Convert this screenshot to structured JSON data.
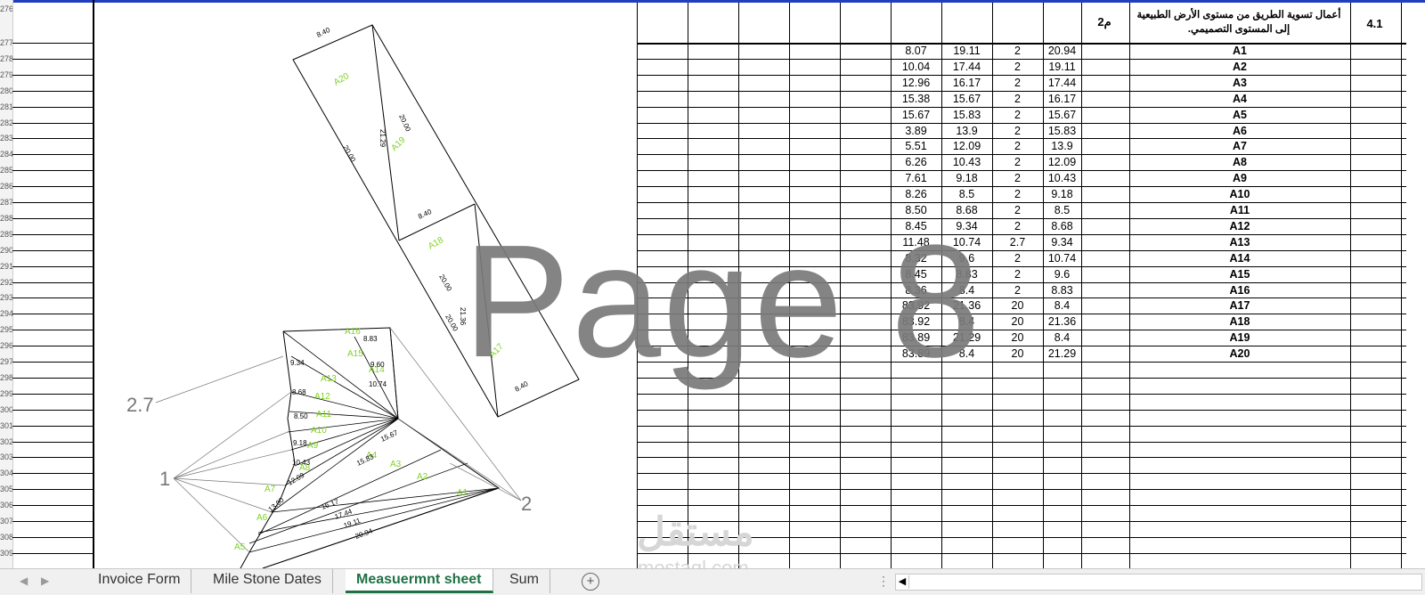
{
  "row_numbers": [
    "276",
    "277",
    "278",
    "279",
    "280",
    "281",
    "282",
    "283",
    "284",
    "285",
    "286",
    "287",
    "288",
    "289",
    "290",
    "291",
    "292",
    "293",
    "294",
    "295",
    "296",
    "297",
    "298",
    "299",
    "300",
    "301",
    "302",
    "303",
    "304",
    "305",
    "306",
    "307",
    "308",
    "309"
  ],
  "table": {
    "header": {
      "code": "4.1",
      "title": "أعمال تسوية الطريق من مستوى الأرض الطبيعية إلى المستوى التصميمي.",
      "unit": "م2"
    },
    "rows": [
      {
        "v1": "8.07",
        "v2": "19.11",
        "v3": "2",
        "v4": "20.94",
        "label": "A1"
      },
      {
        "v1": "10.04",
        "v2": "17.44",
        "v3": "2",
        "v4": "19.11",
        "label": "A2"
      },
      {
        "v1": "12.96",
        "v2": "16.17",
        "v3": "2",
        "v4": "17.44",
        "label": "A3"
      },
      {
        "v1": "15.38",
        "v2": "15.67",
        "v3": "2",
        "v4": "16.17",
        "label": "A4"
      },
      {
        "v1": "15.67",
        "v2": "15.83",
        "v3": "2",
        "v4": "15.67",
        "label": "A5"
      },
      {
        "v1": "3.89",
        "v2": "13.9",
        "v3": "2",
        "v4": "15.83",
        "label": "A6"
      },
      {
        "v1": "5.51",
        "v2": "12.09",
        "v3": "2",
        "v4": "13.9",
        "label": "A7"
      },
      {
        "v1": "6.26",
        "v2": "10.43",
        "v3": "2",
        "v4": "12.09",
        "label": "A8"
      },
      {
        "v1": "7.61",
        "v2": "9.18",
        "v3": "2",
        "v4": "10.43",
        "label": "A9"
      },
      {
        "v1": "8.26",
        "v2": "8.5",
        "v3": "2",
        "v4": "9.18",
        "label": "A10"
      },
      {
        "v1": "8.50",
        "v2": "8.68",
        "v3": "2",
        "v4": "8.5",
        "label": "A11"
      },
      {
        "v1": "8.45",
        "v2": "9.34",
        "v3": "2",
        "v4": "8.68",
        "label": "A12"
      },
      {
        "v1": "11.48",
        "v2": "10.74",
        "v3": "2.7",
        "v4": "9.34",
        "label": "A13"
      },
      {
        "v1": "8.32",
        "v2": "9.6",
        "v3": "2",
        "v4": "10.74",
        "label": "A14"
      },
      {
        "v1": "8.45",
        "v2": "8.83",
        "v3": "2",
        "v4": "9.6",
        "label": "A15"
      },
      {
        "v1": "8.36",
        "v2": "8.4",
        "v3": "2",
        "v4": "8.83",
        "label": "A16"
      },
      {
        "v1": "83.92",
        "v2": "21.36",
        "v3": "20",
        "v4": "8.4",
        "label": "A17"
      },
      {
        "v1": "83.92",
        "v2": "8.4",
        "v3": "20",
        "v4": "21.36",
        "label": "A18"
      },
      {
        "v1": "83.89",
        "v2": "21.29",
        "v3": "20",
        "v4": "8.4",
        "label": "A19"
      },
      {
        "v1": "83.89",
        "v2": "8.4",
        "v3": "20",
        "v4": "21.29",
        "label": "A20"
      }
    ]
  },
  "drawing": {
    "node_labels": {
      "n27": "2.7",
      "n1": "1",
      "n2": "2"
    },
    "area_labels": [
      "A20",
      "A19",
      "A18",
      "A17",
      "A16",
      "A15",
      "A14",
      "A13",
      "A12",
      "A11",
      "A10",
      "A9",
      "A8",
      "A7",
      "A6",
      "A5",
      "A4",
      "A3",
      "A2",
      "A1"
    ],
    "dimensions": [
      "8.40",
      "20.00",
      "21.29",
      "20.00",
      "8.40",
      "20.00",
      "21.36",
      "20.00",
      "8.40",
      "8.83",
      "9.60",
      "9.34",
      "10.74",
      "8.68",
      "8.50",
      "9.18",
      "10.43",
      "12.09",
      "13.90",
      "15.67",
      "15.83",
      "16.17",
      "17.44",
      "19.11",
      "20.94"
    ]
  },
  "watermark": {
    "page_label": "Page 8",
    "brand_arabic": "مستقل",
    "brand_latin": "mostaql.com"
  },
  "tabs": {
    "items": [
      {
        "label": "Invoice Form",
        "active": false
      },
      {
        "label": "Mile Stone Dates",
        "active": false
      },
      {
        "label": "Measuermnt sheet",
        "active": true
      },
      {
        "label": "Sum",
        "active": false
      }
    ],
    "accent_color": "#1e7145"
  },
  "icons": {
    "prev": "triangle-left-icon",
    "next": "triangle-right-icon",
    "add": "plus-circle-icon",
    "more": "vertical-dots-icon",
    "scroll_left": "scroll-left-arrow-icon"
  }
}
